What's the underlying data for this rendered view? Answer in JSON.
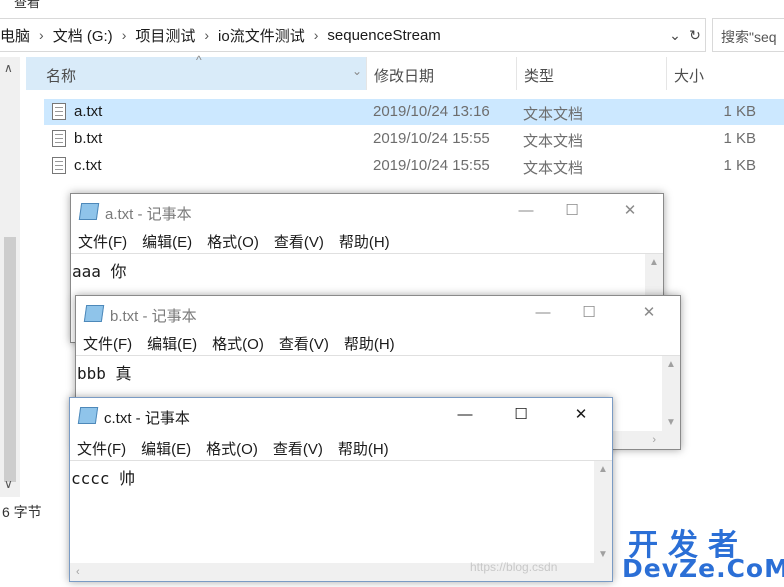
{
  "explorer": {
    "menu_partial": "查看",
    "breadcrumbs": [
      "电脑",
      "文档 (G:)",
      "项目测试",
      "io流文件测试",
      "sequenceStream"
    ],
    "search_placeholder": "搜索\"seq",
    "columns": {
      "name": "名称",
      "modified": "修改日期",
      "type": "类型",
      "size": "大小"
    },
    "files": [
      {
        "name": "a.txt",
        "modified": "2019/10/24 13:16",
        "type": "文本文档",
        "size": "1 KB",
        "selected": true
      },
      {
        "name": "b.txt",
        "modified": "2019/10/24 15:55",
        "type": "文本文档",
        "size": "1 KB",
        "selected": false
      },
      {
        "name": "c.txt",
        "modified": "2019/10/24 15:55",
        "type": "文本文档",
        "size": "1 KB",
        "selected": false
      }
    ],
    "status": "6 字节"
  },
  "menu_items": [
    "文件(F)",
    "编辑(E)",
    "格式(O)",
    "查看(V)",
    "帮助(H)"
  ],
  "windows": [
    {
      "title": "a.txt - 记事本",
      "content": "aaa 你",
      "active": false
    },
    {
      "title": "b.txt - 记事本",
      "content": "bbb 真",
      "active": false
    },
    {
      "title": "c.txt - 记事本",
      "content": "cccc 帅",
      "active": true
    }
  ],
  "icons": {
    "minimize": "minimize-icon",
    "maximize": "maximize-icon",
    "close": "close-icon",
    "notepad": "notepad-icon",
    "file": "text-file-icon"
  },
  "watermark": {
    "line1": "开发者",
    "line2": "DevZe.CoM"
  },
  "csdn_watermark": "https://blog.csdn"
}
